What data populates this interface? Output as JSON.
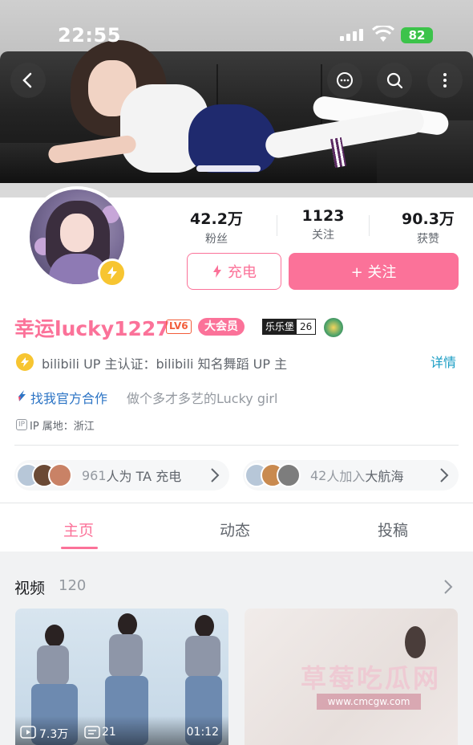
{
  "status_bar": {
    "time": "22:55",
    "battery": "82"
  },
  "profile": {
    "name": "幸运lucky1227",
    "level": "LV6",
    "vip": "大会员",
    "medal": {
      "name": "乐乐堡",
      "level": "26"
    },
    "stats": [
      {
        "value": "42.2万",
        "label": "粉丝"
      },
      {
        "value": "1123",
        "label": "关注"
      },
      {
        "value": "90.3万",
        "label": "获赞"
      }
    ],
    "charge_label": "充电",
    "follow_label": "+ 关注",
    "verification": "bilibili UP 主认证：bilibili 知名舞蹈 UP 主",
    "details_label": "详情",
    "official_link": "找我官方合作",
    "bio": "做个多才多艺的Lucky girl",
    "ip_tag": "IP",
    "ip_location": "IP 属地：浙江",
    "charge_supporters": {
      "count": "961",
      "text": "人为 TA 充电"
    },
    "guard": {
      "count": "42",
      "mid": "人加入",
      "text": "大航海"
    }
  },
  "tabs": [
    {
      "label": "主页",
      "active": true
    },
    {
      "label": "动态",
      "active": false
    },
    {
      "label": "投稿",
      "active": false
    }
  ],
  "videos_section": {
    "title": "视频",
    "count": "120",
    "items": [
      {
        "views": "7.3万",
        "danmaku": "21",
        "duration": "01:12"
      }
    ]
  },
  "watermark": {
    "text": "草莓吃瓜网",
    "url": "www.cmcgw.com"
  },
  "colors": {
    "accent": "#fb7299",
    "link": "#1a9dc4",
    "official": "#2c74c5",
    "level": "#f25d3a"
  }
}
